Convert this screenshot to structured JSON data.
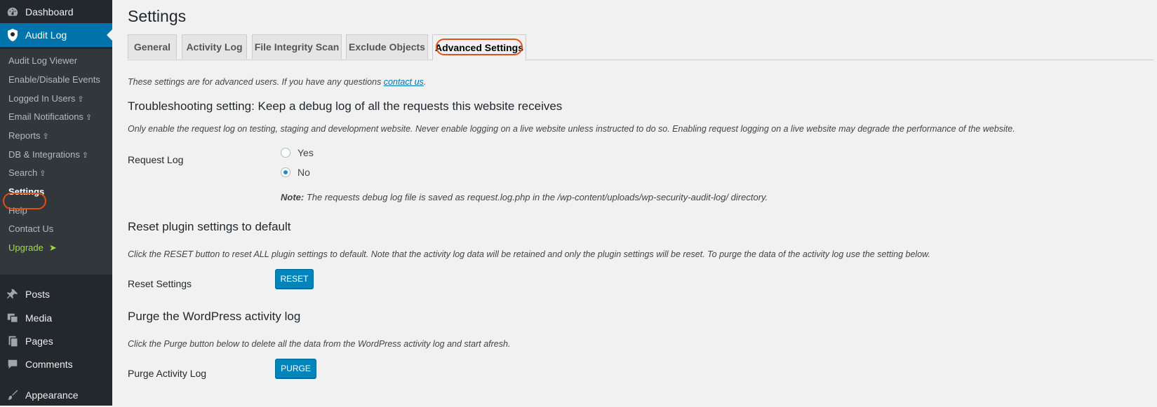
{
  "sidebar": {
    "dashboard": "Dashboard",
    "audit_log": "Audit Log",
    "submenu": [
      {
        "label": "Audit Log Viewer",
        "premium": false
      },
      {
        "label": "Enable/Disable Events",
        "premium": false
      },
      {
        "label": "Logged In Users",
        "premium": true
      },
      {
        "label": "Email Notifications",
        "premium": true
      },
      {
        "label": "Reports",
        "premium": true
      },
      {
        "label": "DB & Integrations",
        "premium": true
      },
      {
        "label": "Search",
        "premium": true
      },
      {
        "label": "Settings",
        "premium": false,
        "current": true
      },
      {
        "label": "Help",
        "premium": false
      },
      {
        "label": "Contact Us",
        "premium": false
      },
      {
        "label": "Upgrade",
        "premium": false
      }
    ],
    "premium_glyph": "⇪",
    "upgrade_arrow": "➤",
    "bottom_items": [
      "Posts",
      "Media",
      "Pages",
      "Comments",
      "Appearance"
    ]
  },
  "page": {
    "title": "Settings",
    "tabs": [
      "General",
      "Activity Log",
      "File Integrity Scan",
      "Exclude Objects",
      "Advanced Settings"
    ],
    "active_tab": "Advanced Settings",
    "intro_prefix": "These settings are for advanced users. If you have any questions ",
    "intro_link": "contact us",
    "intro_suffix": ".",
    "troubleshooting": {
      "heading": "Troubleshooting setting: Keep a debug log of all the requests this website receives",
      "desc": "Only enable the request log on testing, staging and development website. Never enable logging on a live website unless instructed to do so. Enabling request logging on a live website may degrade the performance of the website.",
      "label": "Request Log",
      "options": [
        "Yes",
        "No"
      ],
      "selected": "No",
      "note_label": "Note:",
      "note_text": " The requests debug log file is saved as request.log.php in the /wp-content/uploads/wp-security-audit-log/ directory."
    },
    "reset": {
      "heading": "Reset plugin settings to default",
      "desc": "Click the RESET button to reset ALL plugin settings to default. Note that the activity log data will be retained and only the plugin settings will be reset. To purge the data of the activity log use the setting below.",
      "label": "Reset Settings",
      "button": "RESET"
    },
    "purge": {
      "heading": "Purge the WordPress activity log",
      "desc": "Click the Purge button below to delete all the data from the WordPress activity log and start afresh.",
      "label": "Purge Activity Log",
      "button": "PURGE"
    }
  },
  "colors": {
    "sidebar_bg": "#23282d",
    "submenu_bg": "#32373c",
    "accent": "#0073aa",
    "button": "#0085ba",
    "highlight_circle": "#e0501a",
    "upgrade": "#a6d941"
  }
}
